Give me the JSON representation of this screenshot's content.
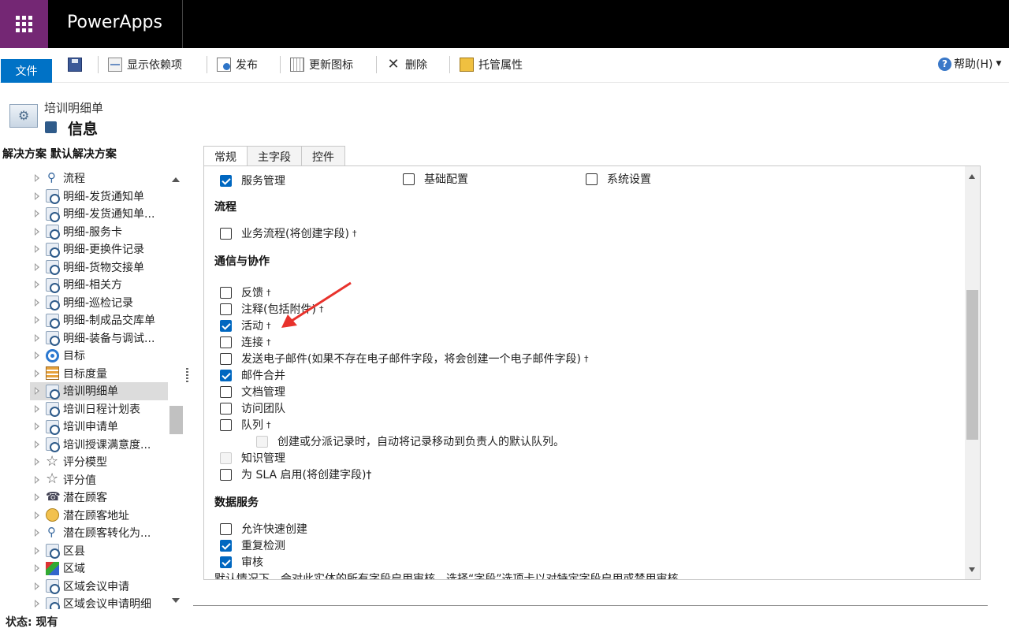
{
  "app": {
    "title": "PowerApps"
  },
  "ribbon": {
    "file": "文件",
    "show_dependencies": "显示依赖项",
    "publish": "发布",
    "update_icons": "更新图标",
    "delete": "删除",
    "managed_properties": "托管属性",
    "help": "帮助(H)"
  },
  "entity": {
    "name": "培训明细单",
    "section": "信息"
  },
  "sidebar": {
    "title": "解决方案 默认解决方案",
    "items": [
      {
        "label": "流程",
        "icon": "process-icon"
      },
      {
        "label": "明细-发货通知单",
        "icon": "entity-icon"
      },
      {
        "label": "明细-发货通知单...",
        "icon": "entity-icon"
      },
      {
        "label": "明细-服务卡",
        "icon": "entity-icon"
      },
      {
        "label": "明细-更换件记录",
        "icon": "entity-icon"
      },
      {
        "label": "明细-货物交接单",
        "icon": "entity-icon"
      },
      {
        "label": "明细-相关方",
        "icon": "entity-icon"
      },
      {
        "label": "明细-巡检记录",
        "icon": "entity-icon"
      },
      {
        "label": "明细-制成品交库单",
        "icon": "entity-icon"
      },
      {
        "label": "明细-装备与调试...",
        "icon": "entity-icon"
      },
      {
        "label": "目标",
        "icon": "target-icon"
      },
      {
        "label": "目标度量",
        "icon": "metric-icon"
      },
      {
        "label": "培训明细单",
        "icon": "entity-icon",
        "selected": true
      },
      {
        "label": "培训日程计划表",
        "icon": "entity-icon"
      },
      {
        "label": "培训申请单",
        "icon": "entity-icon"
      },
      {
        "label": "培训授课满意度...",
        "icon": "entity-icon"
      },
      {
        "label": "评分模型",
        "icon": "star-icon"
      },
      {
        "label": "评分值",
        "icon": "star-icon"
      },
      {
        "label": "潜在顾客",
        "icon": "lead-icon"
      },
      {
        "label": "潜在顾客地址",
        "icon": "lead-address-icon"
      },
      {
        "label": "潜在顾客转化为...",
        "icon": "process-icon"
      },
      {
        "label": "区县",
        "icon": "entity-icon"
      },
      {
        "label": "区域",
        "icon": "region-icon"
      },
      {
        "label": "区域会议申请",
        "icon": "entity-icon"
      },
      {
        "label": "区域会议申请明细",
        "icon": "entity-icon"
      }
    ]
  },
  "tabs": [
    {
      "label": "常规",
      "active": true
    },
    {
      "label": "主字段",
      "active": false
    },
    {
      "label": "控件",
      "active": false
    }
  ],
  "form": {
    "top_options": [
      {
        "label": "服务管理",
        "checked": true
      },
      {
        "label": "基础配置",
        "checked": false
      },
      {
        "label": "系统设置",
        "checked": false
      }
    ],
    "process_title": "流程",
    "business_process": {
      "label": "业务流程(将创建字段)",
      "dagger": "†",
      "checked": false
    },
    "comm_title": "通信与协作",
    "comm_items": [
      {
        "label": "反馈",
        "dagger": "†",
        "checked": false
      },
      {
        "label": "注释(包括附件)",
        "dagger": "†",
        "checked": false
      },
      {
        "label": "活动",
        "dagger": "†",
        "checked": true
      },
      {
        "label": "连接",
        "dagger": "†",
        "checked": false
      },
      {
        "label": "发送电子邮件(如果不存在电子邮件字段，将会创建一个电子邮件字段)",
        "dagger": "†",
        "checked": false
      },
      {
        "label": "邮件合并",
        "dagger": "",
        "checked": true
      },
      {
        "label": "文档管理",
        "dagger": "",
        "checked": false
      },
      {
        "label": "访问团队",
        "dagger": "",
        "checked": false
      },
      {
        "label": "队列",
        "dagger": "†",
        "checked": false
      }
    ],
    "queue_sub": "创建或分派记录时，自动将记录移动到负责人的默认队列。",
    "knowledge": "知识管理",
    "sla": "为 SLA 启用(将创建字段)†",
    "data_title": "数据服务",
    "data_items": [
      {
        "label": "允许快速创建",
        "checked": false
      },
      {
        "label": "重复检测",
        "checked": true
      },
      {
        "label": "审核",
        "checked": true
      }
    ],
    "audit_note": "默认情况下，会对此实体的所有字段启用审核。选择“字段”选项卡以对特定字段启用或禁用审核。"
  },
  "status": {
    "text": "状态: 现有"
  }
}
